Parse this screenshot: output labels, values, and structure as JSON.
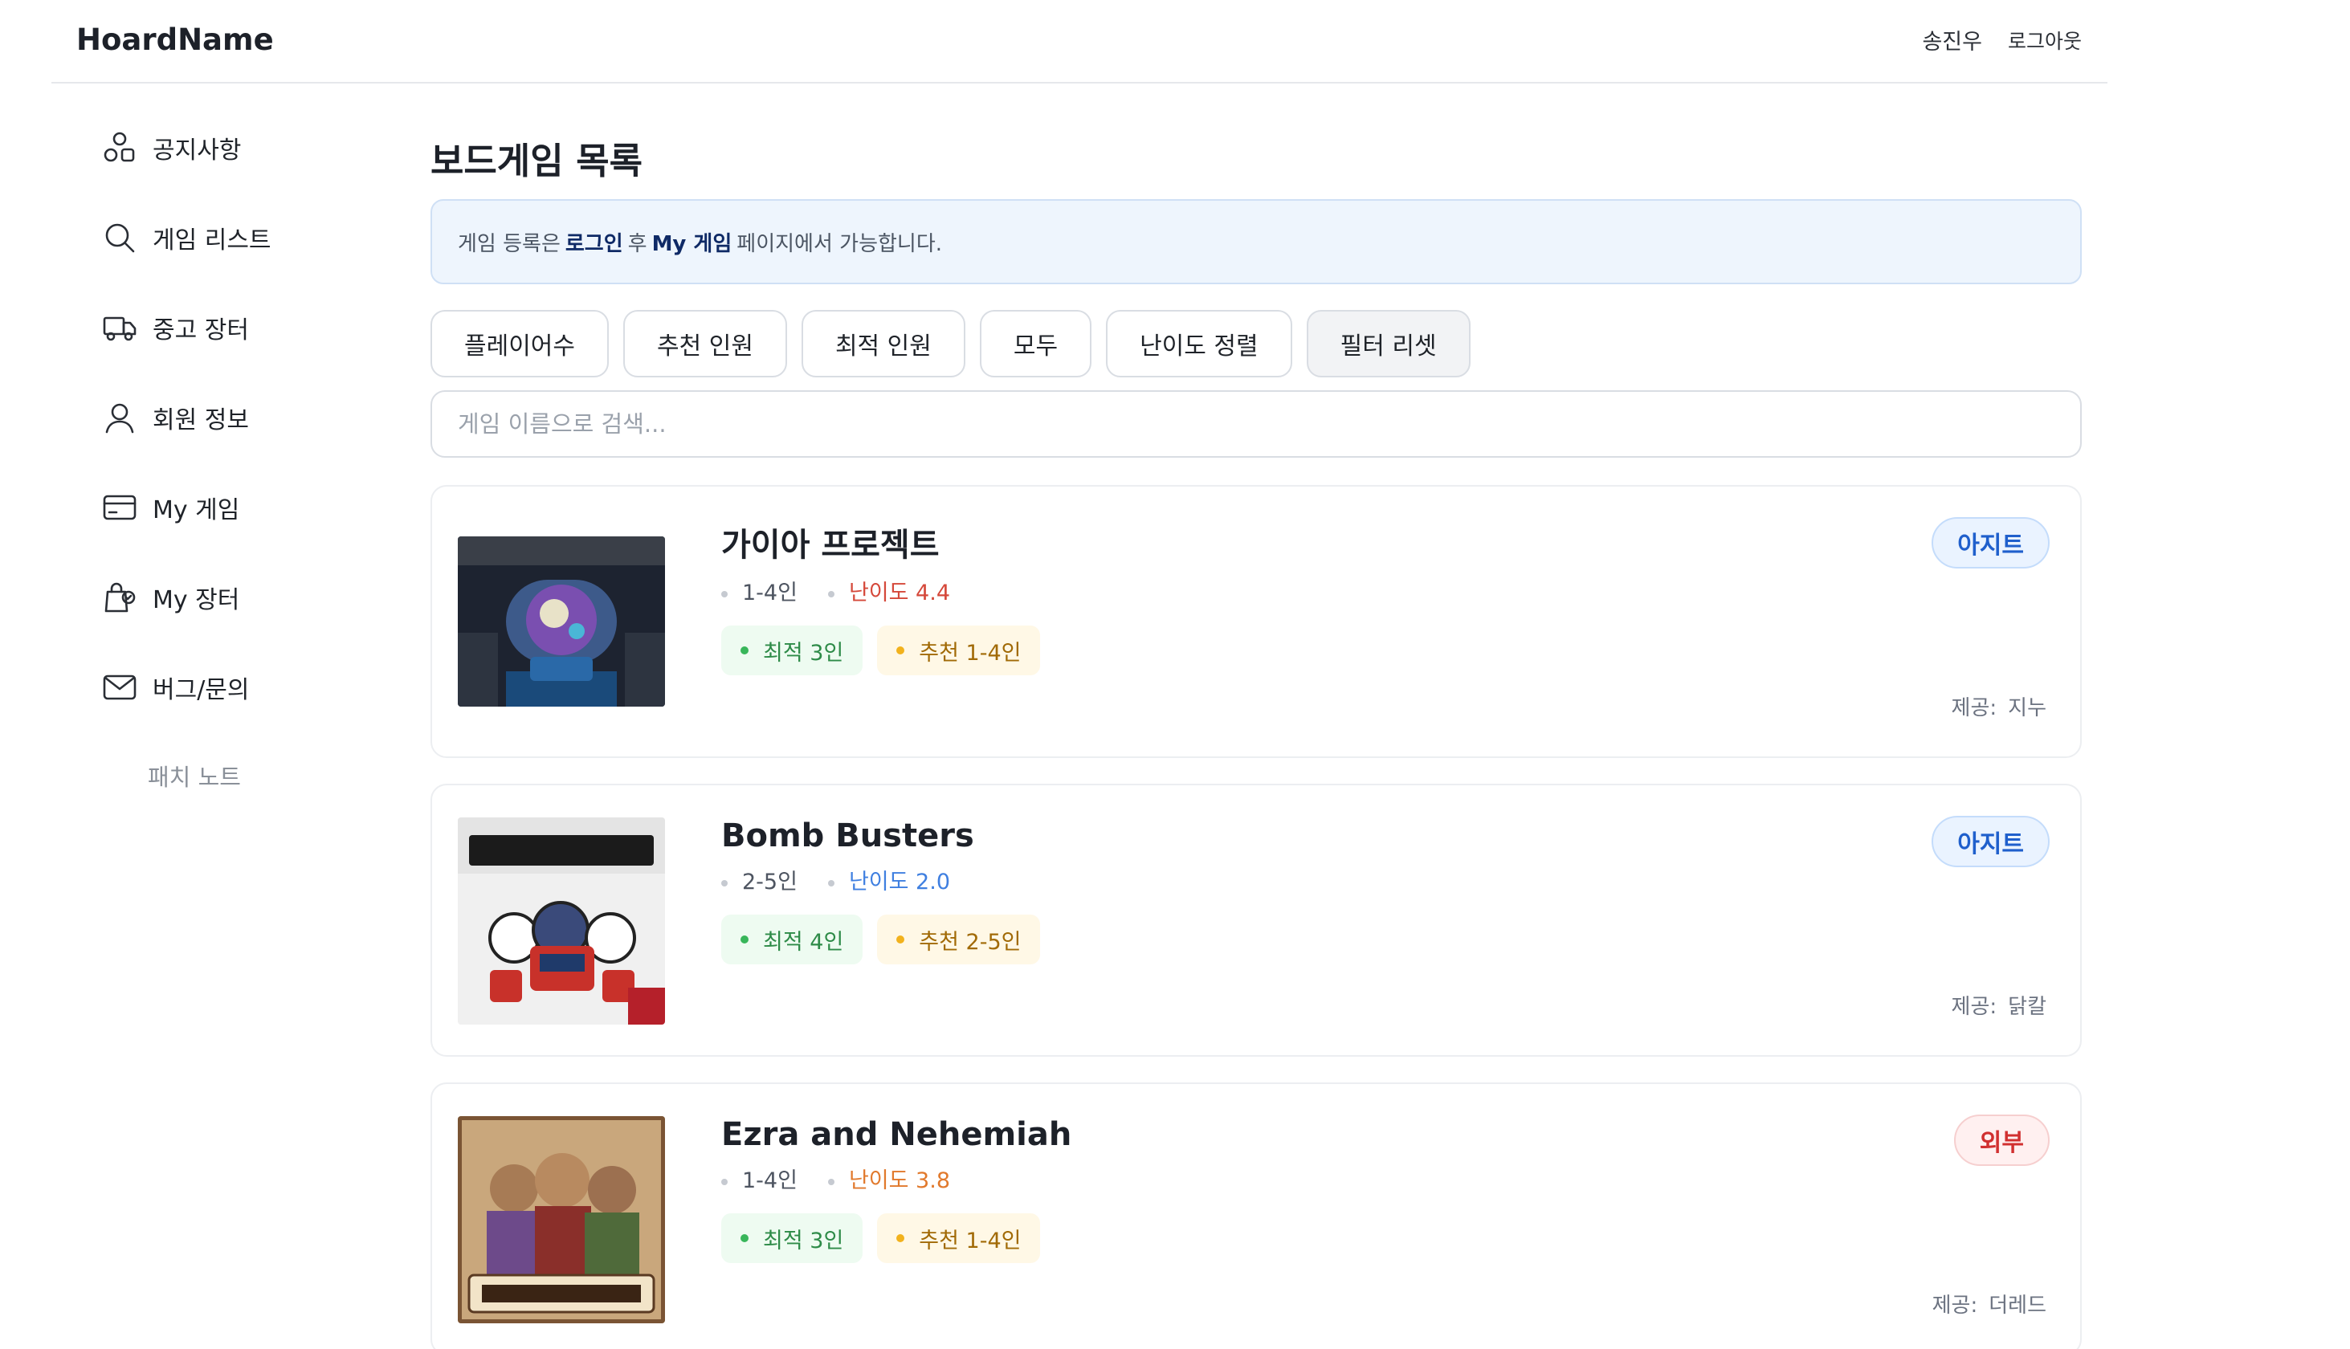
{
  "header": {
    "logo": "HoardName",
    "user_name": "송진우",
    "logout_label": "로그아웃"
  },
  "sidebar": {
    "items": [
      {
        "label": "공지사항",
        "icon": "shapes-icon"
      },
      {
        "label": "게임 리스트",
        "icon": "search-icon"
      },
      {
        "label": "중고 장터",
        "icon": "truck-icon"
      },
      {
        "label": "회원 정보",
        "icon": "user-icon"
      },
      {
        "label": "My 게임",
        "icon": "card-icon"
      },
      {
        "label": "My 장터",
        "icon": "shopping-bag-icon"
      },
      {
        "label": "버그/문의",
        "icon": "mail-icon"
      }
    ],
    "patch_notes": "패치 노트"
  },
  "main": {
    "title": "보드게임 목록",
    "notice": {
      "prefix": "게임 등록은",
      "login": "로그인",
      "middle": "후",
      "my_game": "My 게임",
      "suffix": "페이지에서 가능합니다."
    },
    "filters": [
      "플레이어수",
      "추천 인원",
      "최적 인원",
      "모두",
      "난이도 정렬",
      "필터 리셋"
    ],
    "search_placeholder": "게임 이름으로 검색...",
    "provider_label": "제공:",
    "games": [
      {
        "title": "가이아 프로젝트",
        "players": "1-4인",
        "difficulty": "난이도 4.4",
        "best": "최적 3인",
        "recommended": "추천 1-4인",
        "badge": "아지트",
        "provider": "지누"
      },
      {
        "title": "Bomb Busters",
        "players": "2-5인",
        "difficulty": "난이도 2.0",
        "best": "최적 4인",
        "recommended": "추천 2-5인",
        "badge": "아지트",
        "provider": "닭칼"
      },
      {
        "title": "Ezra and Nehemiah",
        "players": "1-4인",
        "difficulty": "난이도 3.8",
        "best": "최적 3인",
        "recommended": "추천 1-4인",
        "badge": "외부",
        "provider": "더레드"
      }
    ]
  },
  "colors": {
    "accent_blue": "#1f5fcc",
    "external_red": "#d13030",
    "best_green": "#38b65a",
    "recommend_yellow": "#f2b21d"
  }
}
